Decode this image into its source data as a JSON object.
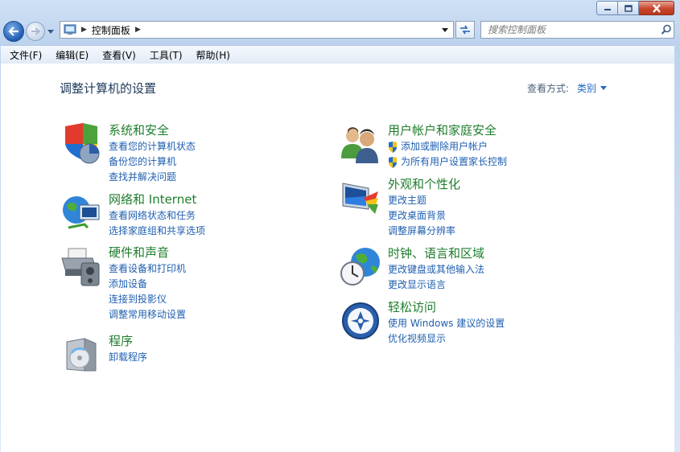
{
  "window": {
    "controls": {
      "minimize": "minimize",
      "maximize": "maximize",
      "close": "close"
    }
  },
  "address": {
    "crumbs": [
      "控制面板"
    ]
  },
  "search": {
    "placeholder": "搜索控制面板"
  },
  "menu": [
    {
      "label": "文件(F)"
    },
    {
      "label": "编辑(E)"
    },
    {
      "label": "查看(V)"
    },
    {
      "label": "工具(T)"
    },
    {
      "label": "帮助(H)"
    }
  ],
  "page": {
    "heading": "调整计算机的设置",
    "view_by_label": "查看方式:",
    "view_by_value": "类别"
  },
  "categories": [
    {
      "title": "系统和安全",
      "icon": "shield-pie-icon",
      "links": [
        "查看您的计算机状态",
        "备份您的计算机",
        "查找并解决问题"
      ]
    },
    {
      "title": "网络和 Internet",
      "icon": "network-globe-icon",
      "links": [
        "查看网络状态和任务",
        "选择家庭组和共享选项"
      ]
    },
    {
      "title": "硬件和声音",
      "icon": "printer-speaker-icon",
      "links": [
        "查看设备和打印机",
        "添加设备",
        "连接到投影仪",
        "调整常用移动设置"
      ]
    },
    {
      "title": "程序",
      "icon": "program-box-icon",
      "links": [
        "卸载程序"
      ]
    },
    {
      "title": "用户帐户和家庭安全",
      "icon": "users-icon",
      "links": [
        "添加或删除用户帐户",
        "为所有用户设置家长控制"
      ],
      "shielded": true
    },
    {
      "title": "外观和个性化",
      "icon": "monitor-palette-icon",
      "links": [
        "更改主题",
        "更改桌面背景",
        "调整屏幕分辨率"
      ]
    },
    {
      "title": "时钟、语言和区域",
      "icon": "clock-globe-icon",
      "links": [
        "更改键盘或其他输入法",
        "更改显示语言"
      ]
    },
    {
      "title": "轻松访问",
      "icon": "ease-of-access-icon",
      "links": [
        "使用 Windows 建议的设置",
        "优化视频显示"
      ]
    }
  ],
  "colors": {
    "category_title": "#1e7d2c",
    "link": "#1f5fb0",
    "heading": "#1e395b",
    "chrome": "#bcd3ee",
    "close_button": "#c8452c"
  }
}
